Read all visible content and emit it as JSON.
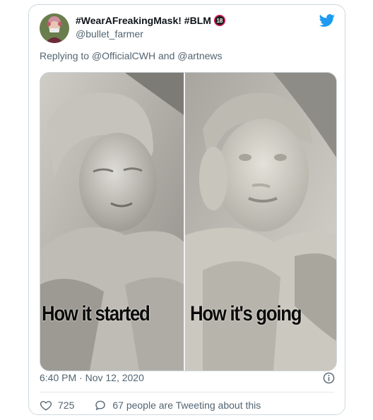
{
  "tweet": {
    "display_name": "#WearAFreakingMask! #BLM",
    "badge": "18",
    "handle": "@bullet_farmer",
    "reply_prefix": "Replying to",
    "reply_to_1": "@OfficialCWH",
    "reply_and": "and",
    "reply_to_2": "@artnews",
    "image_captions": [
      "How it started",
      "How it's going"
    ],
    "time": "6:40 PM",
    "separator": "·",
    "date": "Nov 12, 2020",
    "likes": "725",
    "discussion": "67 people are Tweeting about this"
  },
  "icons": {
    "brand": "twitter-bird-icon",
    "info": "info-icon",
    "like": "heart-icon",
    "reply": "speech-bubble-icon"
  },
  "colors": {
    "brand_blue": "#1d9bf0",
    "secondary_text": "#536471",
    "border": "#cfd9de"
  }
}
